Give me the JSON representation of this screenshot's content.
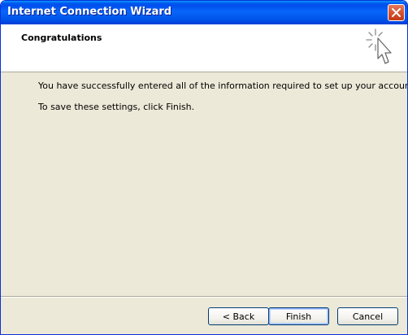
{
  "window": {
    "title": "Internet Connection Wizard"
  },
  "header": {
    "title": "Congratulations",
    "icon": "wizard-cursor-sparkle-icon"
  },
  "content": {
    "line1": "You have successfully entered all of the information required to set up your account.",
    "line2": "To save these settings, click Finish."
  },
  "buttons": {
    "back": "< Back",
    "finish": "Finish",
    "cancel": "Cancel"
  },
  "colors": {
    "titlebar": "#0053ee",
    "dialog_bg": "#ece9d8",
    "close_button": "#d5502c"
  }
}
